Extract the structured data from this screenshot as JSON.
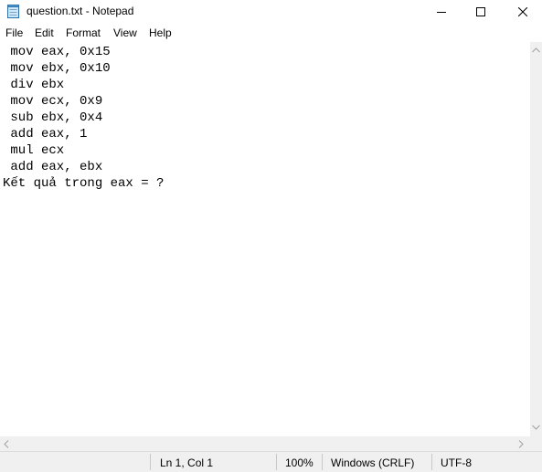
{
  "window": {
    "title": "question.txt - Notepad",
    "icons": {
      "app": "notepad-icon",
      "minimize": "minimize-icon",
      "maximize": "maximize-icon",
      "close": "close-icon"
    }
  },
  "menu": {
    "items": [
      "File",
      "Edit",
      "Format",
      "View",
      "Help"
    ]
  },
  "editor": {
    "lines": [
      " mov eax, 0x15",
      " mov ebx, 0x10",
      " div ebx",
      " mov ecx, 0x9",
      " sub ebx, 0x4",
      " add eax, 1",
      " mul ecx",
      " add eax, ebx",
      "Kết quả trong eax = ?"
    ]
  },
  "status": {
    "position": "Ln 1, Col 1",
    "zoom": "100%",
    "line_ending": "Windows (CRLF)",
    "encoding": "UTF-8"
  }
}
